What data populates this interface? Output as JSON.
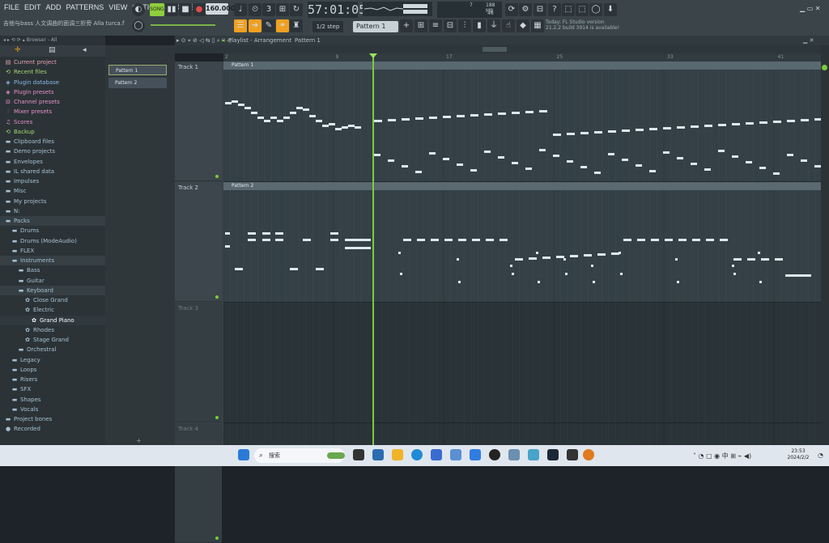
{
  "menu": [
    "FILE",
    "EDIT",
    "ADD",
    "PATTERNS",
    "VIEW",
    "OPTIONS",
    "TOOLS",
    "HELP"
  ],
  "project_file": "吉他与bass 人文调曲的面调三折旁 Alla  turca.flp",
  "transport": {
    "mode": "SONG",
    "bpm": "160.000",
    "time": "57:01:05"
  },
  "cpu": {
    "memory": "188 MB",
    "value": "46",
    "polyphony": "7"
  },
  "step": "1/2 step",
  "pattern_selector": "Pattern 1",
  "news": {
    "line1": "Today: FL Studio version",
    "line2": "21.2.2 build 3914 is available!"
  },
  "browser": {
    "header": "Browser - All",
    "items": [
      {
        "label": "Current project",
        "icon": "project-icon",
        "color": "#e8a0b0",
        "indent": 0
      },
      {
        "label": "Recent files",
        "icon": "recent-icon",
        "color": "#a8d870",
        "indent": 0
      },
      {
        "label": "Plugin database",
        "icon": "plugin-icon",
        "color": "#8ab8e8",
        "indent": 0
      },
      {
        "label": "Plugin presets",
        "icon": "plugin-icon",
        "color": "#e890c8",
        "indent": 0
      },
      {
        "label": "Channel presets",
        "icon": "channel-icon",
        "color": "#e890c8",
        "indent": 0
      },
      {
        "label": "Mixer presets",
        "icon": "mixer-icon",
        "color": "#e890c8",
        "indent": 0
      },
      {
        "label": "Scores",
        "icon": "score-icon",
        "color": "#e890c8",
        "indent": 0
      },
      {
        "label": "Backup",
        "icon": "backup-icon",
        "color": "#a8d870",
        "indent": 0
      },
      {
        "label": "Clipboard files",
        "icon": "folder-icon",
        "color": "#a8c0d0",
        "indent": 0
      },
      {
        "label": "Demo projects",
        "icon": "folder-icon",
        "color": "#a8c0d0",
        "indent": 0
      },
      {
        "label": "Envelopes",
        "icon": "folder-icon",
        "color": "#a8c0d0",
        "indent": 0
      },
      {
        "label": "IL shared data",
        "icon": "folder-icon",
        "color": "#a8c0d0",
        "indent": 0
      },
      {
        "label": "Impulses",
        "icon": "folder-icon",
        "color": "#a8c0d0",
        "indent": 0
      },
      {
        "label": "Misc",
        "icon": "folder-icon",
        "color": "#a8c0d0",
        "indent": 0
      },
      {
        "label": "My projects",
        "icon": "folder-icon",
        "color": "#a8c0d0",
        "indent": 0
      },
      {
        "label": "N:",
        "icon": "folder-icon",
        "color": "#a8c0d0",
        "indent": 0
      },
      {
        "label": "Packs",
        "icon": "folder-icon",
        "color": "#a8c0d0",
        "indent": 0
      },
      {
        "label": "Drums",
        "icon": "folder-icon",
        "color": "#a8c0d0",
        "indent": 1
      },
      {
        "label": "Drums (ModeAudio)",
        "icon": "folder-icon",
        "color": "#a8c0d0",
        "indent": 1
      },
      {
        "label": "FLEX",
        "icon": "folder-icon",
        "color": "#a8c0d0",
        "indent": 1
      },
      {
        "label": "Instruments",
        "icon": "folder-icon",
        "color": "#a8c0d0",
        "indent": 1
      },
      {
        "label": "Bass",
        "icon": "folder-icon",
        "color": "#a8c0d0",
        "indent": 2
      },
      {
        "label": "Guitar",
        "icon": "folder-icon",
        "color": "#a8c0d0",
        "indent": 2
      },
      {
        "label": "Keyboard",
        "icon": "folder-icon",
        "color": "#a8c0d0",
        "indent": 2
      },
      {
        "label": "Close Grand",
        "icon": "preset-icon",
        "color": "#a8c0d0",
        "indent": 3
      },
      {
        "label": "Electric",
        "icon": "preset-icon",
        "color": "#a8c0d0",
        "indent": 3
      },
      {
        "label": "Grand Piano",
        "icon": "preset-icon",
        "color": "#ffffff",
        "indent": 4
      },
      {
        "label": "Rhodes",
        "icon": "preset-icon",
        "color": "#a8c0d0",
        "indent": 3
      },
      {
        "label": "Stage Grand",
        "icon": "preset-icon",
        "color": "#a8c0d0",
        "indent": 3
      },
      {
        "label": "Orchestral",
        "icon": "folder-icon",
        "color": "#a8c0d0",
        "indent": 2
      },
      {
        "label": "Legacy",
        "icon": "folder-icon",
        "color": "#a8c0d0",
        "indent": 1
      },
      {
        "label": "Loops",
        "icon": "folder-icon",
        "color": "#a8c0d0",
        "indent": 1
      },
      {
        "label": "Risers",
        "icon": "folder-icon",
        "color": "#a8c0d0",
        "indent": 1
      },
      {
        "label": "SFX",
        "icon": "folder-icon",
        "color": "#a8c0d0",
        "indent": 1
      },
      {
        "label": "Shapes",
        "icon": "folder-icon",
        "color": "#a8c0d0",
        "indent": 1
      },
      {
        "label": "Vocals",
        "icon": "folder-icon",
        "color": "#a8c0d0",
        "indent": 1
      },
      {
        "label": "Project bones",
        "icon": "folder-icon",
        "color": "#a8c0d0",
        "indent": 0
      },
      {
        "label": "Recorded",
        "icon": "recorded-icon",
        "color": "#a8c0d0",
        "indent": 0
      }
    ]
  },
  "patterns": [
    "Pattern 1",
    "Pattern 2"
  ],
  "playlist": {
    "title": "Playlist - Arrangement",
    "current_pattern": "Pattern 1",
    "tracks": [
      "Track 1",
      "Track 2",
      "Track 3",
      "Track 4"
    ],
    "clips": [
      {
        "track": 0,
        "label": "Pattern 1"
      },
      {
        "track": 1,
        "label": "Pattern 2"
      }
    ],
    "timeline_marks": [
      "2",
      "9",
      "17",
      "25",
      "33",
      "41"
    ]
  },
  "taskbar": {
    "search_placeholder": "搜索",
    "time": "23:53",
    "date": "2024/2/2"
  }
}
